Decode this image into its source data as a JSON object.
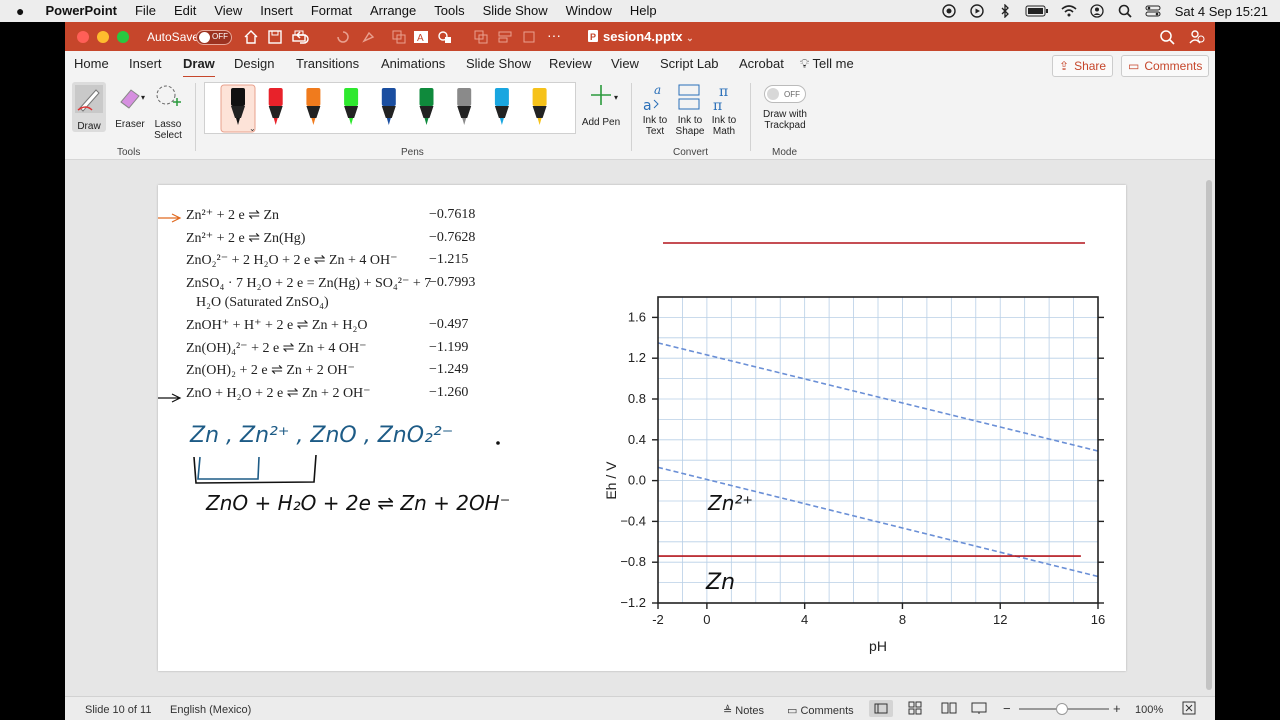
{
  "menubar": {
    "app_name": "PowerPoint",
    "items": [
      "File",
      "Edit",
      "View",
      "Insert",
      "Format",
      "Arrange",
      "Tools",
      "Slide Show",
      "Window",
      "Help"
    ],
    "clock": "Sat 4 Sep  15:21"
  },
  "titlebar": {
    "autosave_label": "AutoSave",
    "autosave_state": "OFF",
    "doc_title": "sesion4.pptx"
  },
  "tabs": [
    "Home",
    "Insert",
    "Draw",
    "Design",
    "Transitions",
    "Animations",
    "Slide Show",
    "Review",
    "View",
    "Script Lab",
    "Acrobat"
  ],
  "active_tab": "Draw",
  "tell_me": "Tell me",
  "share_label": "Share",
  "comments_label": "Comments",
  "ribbon": {
    "tools": {
      "draw": "Draw",
      "eraser": "Eraser",
      "lasso_line1": "Lasso",
      "lasso_line2": "Select",
      "group": "Tools"
    },
    "pens": {
      "colors": [
        "#111111",
        "#e8222a",
        "#f07b1d",
        "#2ee82e",
        "#1a4ea0",
        "#0f8a3c",
        "#8a8a8a",
        "#19a6e0",
        "#f6c21a"
      ],
      "add_pen": "Add Pen",
      "group": "Pens"
    },
    "convert": {
      "ink_to_text_1": "Ink to",
      "ink_to_text_2": "Text",
      "ink_to_shape_1": "Ink to",
      "ink_to_shape_2": "Shape",
      "ink_to_math_1": "Ink to",
      "ink_to_math_2": "Math",
      "group": "Convert"
    },
    "mode": {
      "toggle": "OFF",
      "label_1": "Draw with",
      "label_2": "Trackpad",
      "group": "Mode"
    }
  },
  "slide": {
    "reactions": [
      {
        "eq": "Zn²⁺ + 2 e ⇌ Zn",
        "value": "−0.7618"
      },
      {
        "eq": "Zn²⁺ + 2 e ⇌ Zn(Hg)",
        "value": "−0.7628"
      },
      {
        "eq": "ZnO₂²⁻ + 2 H₂O + 2 e ⇌ Zn + 4 OH⁻",
        "value": "−1.215"
      },
      {
        "eq": "ZnSO₄ · 7 H₂O + 2 e = Zn(Hg) + SO₄²⁻ + 7",
        "eq2": "H₂O (Saturated ZnSO₄)",
        "value": "−0.7993"
      },
      {
        "eq": "ZnOH⁺ + H⁺ + 2 e ⇌ Zn + H₂O",
        "value": "−0.497"
      },
      {
        "eq": "Zn(OH)₄²⁻ + 2 e ⇌ Zn + 4 OH⁻",
        "value": "−1.199"
      },
      {
        "eq": "Zn(OH)₂ + 2 e ⇌ Zn + 2 OH⁻",
        "value": "−1.249"
      },
      {
        "eq": "ZnO + H₂O + 2 e ⇌ Zn + 2 OH⁻",
        "value": "−1.260"
      }
    ],
    "handwriting": {
      "species": "Zn , Zn²⁺ , ZnO , ZnO₂²⁻",
      "equation": "ZnO + H₂O + 2e ⇌ Zn + 2OH⁻",
      "region_upper": "Zn²⁺",
      "region_lower": "Zn"
    }
  },
  "chart_data": {
    "type": "line",
    "xlabel": "pH",
    "ylabel": "Eh / V",
    "xlim": [
      -2,
      16
    ],
    "ylim": [
      -1.2,
      1.8
    ],
    "xticks": [
      -2,
      0,
      4,
      8,
      12,
      16
    ],
    "yticks": [
      -1.2,
      -0.8,
      -0.4,
      0,
      0.4,
      0.8,
      1.2,
      1.6
    ],
    "grid": true,
    "series": [
      {
        "style": "dashed",
        "color": "#6a8fd6",
        "x": [
          -2,
          16
        ],
        "y": [
          1.35,
          0.29
        ]
      },
      {
        "style": "dashed",
        "color": "#6a8fd6",
        "x": [
          -2,
          16
        ],
        "y": [
          0.13,
          -0.94
        ]
      },
      {
        "style": "solid",
        "color": "#b3141b",
        "x": [
          -2,
          15.3
        ],
        "y": [
          -0.74,
          -0.74
        ]
      }
    ]
  },
  "status": {
    "slide_info": "Slide 10 of 11",
    "language": "English (Mexico)",
    "notes": "Notes",
    "comments": "Comments",
    "zoom": "100%"
  }
}
